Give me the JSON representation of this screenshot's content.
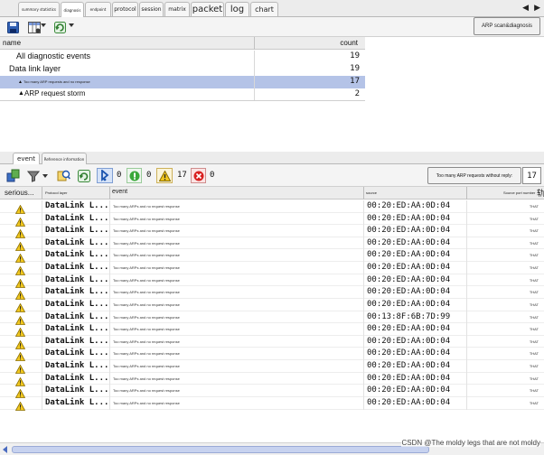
{
  "top_tabs": [
    "summary statistics",
    "diagnosis",
    "endpoint",
    "protocol",
    "session",
    "matrix",
    "packet",
    "log",
    "chart"
  ],
  "top_active_tab": 1,
  "arp_button": "ARP scan&diagnosis",
  "diag_table": {
    "col_name": "name",
    "col_count": "count",
    "rows": [
      {
        "label": "All diagnostic events",
        "count": "19"
      },
      {
        "label": "Data link layer",
        "count": "19"
      },
      {
        "label": "Too many ARP requests and no response",
        "count": "17"
      },
      {
        "label": "ARP request storm",
        "count": "2"
      }
    ]
  },
  "bottom_tabs": [
    "event",
    "Reference information"
  ],
  "counts": {
    "info": "0",
    "notice": "0",
    "warning": "17",
    "error": "0"
  },
  "filter": {
    "label": "Too many ARP requests without reply:",
    "value": "17"
  },
  "event_table": {
    "headers": [
      "serious...",
      "Protocol layer",
      "event",
      "source",
      "Source port number"
    ],
    "rows": [
      {
        "layer": "DataLink L...",
        "event": "Too many ARPs and no request response",
        "source": "00:20:ED:AA:0D:04",
        "port": "THAT"
      },
      {
        "layer": "DataLink L...",
        "event": "Too many ARPs and no request response",
        "source": "00:20:ED:AA:0D:04",
        "port": "THAT"
      },
      {
        "layer": "DataLink L...",
        "event": "Too many ARPs and no request response",
        "source": "00:20:ED:AA:0D:04",
        "port": "THAT"
      },
      {
        "layer": "DataLink L...",
        "event": "Too many ARPs and no request response",
        "source": "00:20:ED:AA:0D:04",
        "port": "THAT"
      },
      {
        "layer": "DataLink L...",
        "event": "Too many ARPs and no request response",
        "source": "00:20:ED:AA:0D:04",
        "port": "THAT"
      },
      {
        "layer": "DataLink L...",
        "event": "Too many ARPs and no request response",
        "source": "00:20:ED:AA:0D:04",
        "port": "THAT"
      },
      {
        "layer": "DataLink L...",
        "event": "Too many ARPs and no request response",
        "source": "00:20:ED:AA:0D:04",
        "port": "THAT"
      },
      {
        "layer": "DataLink L...",
        "event": "Too many ARPs and no request response",
        "source": "00:20:ED:AA:0D:04",
        "port": "THAT"
      },
      {
        "layer": "DataLink L...",
        "event": "Too many ARPs and no request response",
        "source": "00:20:ED:AA:0D:04",
        "port": "THAT"
      },
      {
        "layer": "DataLink L...",
        "event": "Too many ARPs and no request response",
        "source": "00:13:8F:6B:7D:99",
        "port": "THAT"
      },
      {
        "layer": "DataLink L...",
        "event": "Too many ARPs and no request response",
        "source": "00:20:ED:AA:0D:04",
        "port": "THAT"
      },
      {
        "layer": "DataLink L...",
        "event": "Too many ARPs and no request response",
        "source": "00:20:ED:AA:0D:04",
        "port": "THAT"
      },
      {
        "layer": "DataLink L...",
        "event": "Too many ARPs and no request response",
        "source": "00:20:ED:AA:0D:04",
        "port": "THAT"
      },
      {
        "layer": "DataLink L...",
        "event": "Too many ARPs and no request response",
        "source": "00:20:ED:AA:0D:04",
        "port": "THAT"
      },
      {
        "layer": "DataLink L...",
        "event": "Too many ARPs and no request response",
        "source": "00:20:ED:AA:0D:04",
        "port": "THAT"
      },
      {
        "layer": "DataLink L...",
        "event": "Too many ARPs and no request response",
        "source": "00:20:ED:AA:0D:04",
        "port": "THAT"
      },
      {
        "layer": "DataLink L...",
        "event": "Too many ARPs and no request response",
        "source": "00:20:ED:AA:0D:04",
        "port": "THAT"
      }
    ]
  },
  "watermark": "CSDN @The moldy legs that are not moldy",
  "colors": {
    "selected_row": "#b4c3e7",
    "warning": "#f2c81e",
    "ok_green": "#3aa83a",
    "error_red": "#d92020"
  }
}
